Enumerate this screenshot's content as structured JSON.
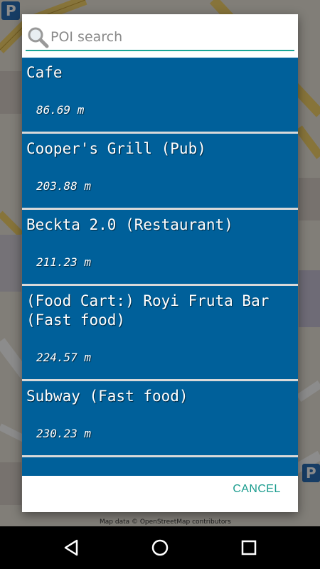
{
  "search": {
    "placeholder": "POI search",
    "value": ""
  },
  "results": [
    {
      "name": "Cafe",
      "distance": "86.69 m"
    },
    {
      "name": "Cooper's Grill (Pub)",
      "distance": "203.88 m"
    },
    {
      "name": "Beckta 2.0 (Restaurant)",
      "distance": "211.23 m"
    },
    {
      "name": "(Food Cart:) Royi Fruta Bar (Fast food)",
      "distance": "224.57 m"
    },
    {
      "name": "Subway (Fast food)",
      "distance": "230.23 m"
    }
  ],
  "dialog": {
    "cancel_label": "CANCEL"
  },
  "map": {
    "attribution": "Map data © OpenStreetMap contributors"
  },
  "colors": {
    "item_bg": "#00609a",
    "accent": "#1aa595",
    "cancel_text": "#1a9c8e"
  },
  "nav": {
    "back_icon": "back-icon",
    "home_icon": "home-icon",
    "recents_icon": "recents-icon"
  }
}
